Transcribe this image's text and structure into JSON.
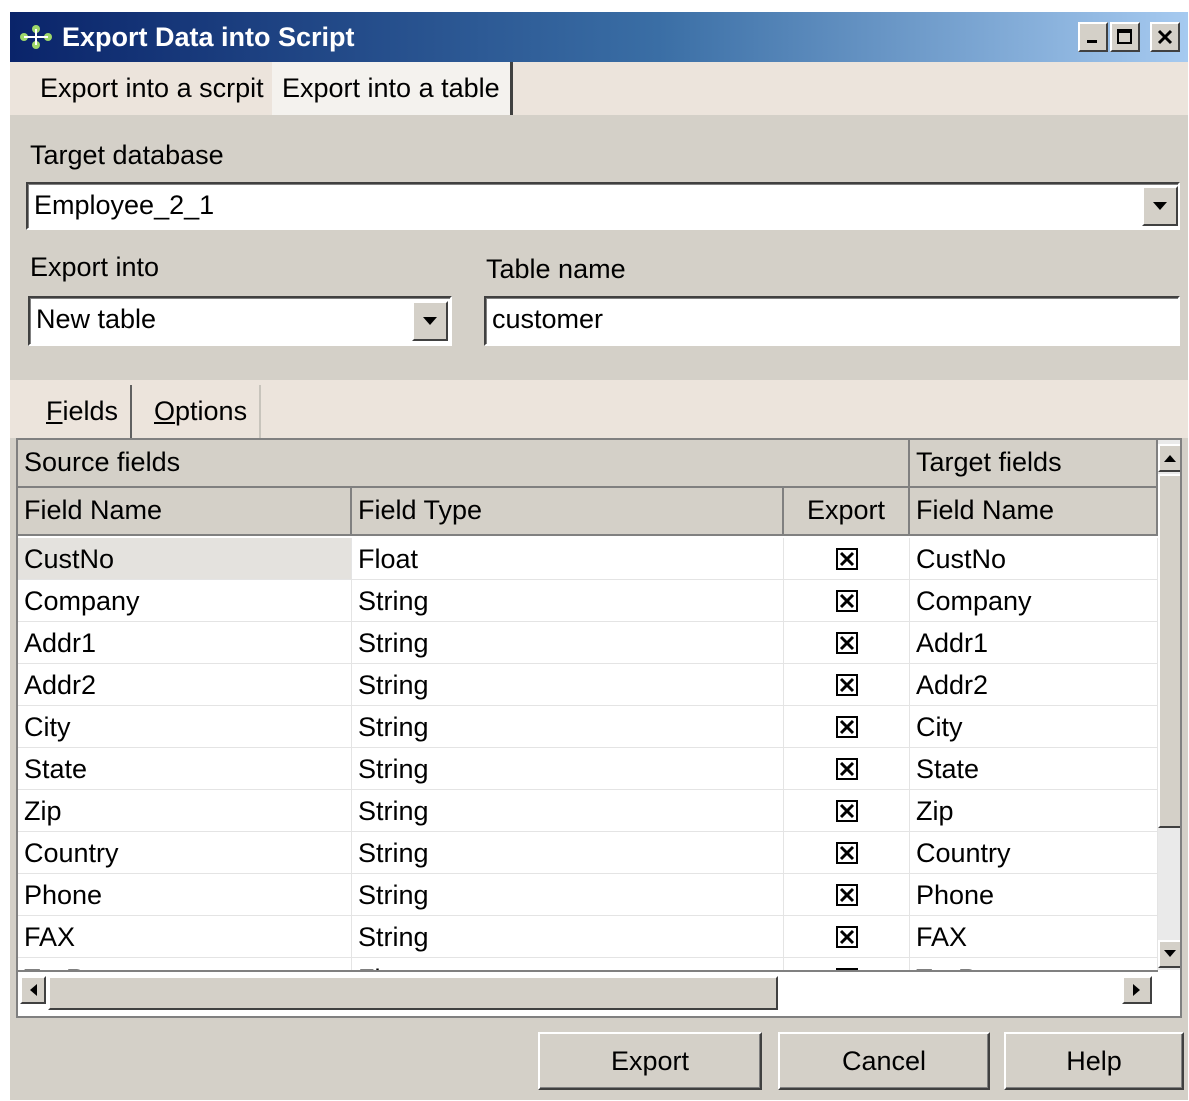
{
  "window": {
    "title": "Export Data into Script",
    "controls": {
      "minimize": "_",
      "maximize": "□",
      "close": "×"
    }
  },
  "tabs": [
    {
      "label": "Export into a scrpit",
      "active": false
    },
    {
      "label": "Export into a table",
      "active": true
    }
  ],
  "form": {
    "target_database_label": "Target database",
    "target_database_value": "Employee_2_1",
    "export_into_label": "Export into",
    "export_into_value": "New table",
    "table_name_label": "Table name",
    "table_name_value": "customer"
  },
  "subtabs": [
    {
      "label": "Fields",
      "mnemonic": "F",
      "rest": "ields",
      "active": true
    },
    {
      "label": "Options",
      "mnemonic": "O",
      "rest": "ptions",
      "active": false
    }
  ],
  "grid": {
    "group_headers": {
      "source": "Source fields",
      "target": "Target fields"
    },
    "columns": {
      "source_field_name": "Field Name",
      "source_field_type": "Field Type",
      "export": "Export",
      "target_field_name": "Field Name"
    },
    "rows": [
      {
        "name": "CustNo",
        "type": "Float",
        "export": true,
        "target": "CustNo",
        "selected": true
      },
      {
        "name": "Company",
        "type": "String",
        "export": true,
        "target": "Company"
      },
      {
        "name": "Addr1",
        "type": "String",
        "export": true,
        "target": "Addr1"
      },
      {
        "name": "Addr2",
        "type": "String",
        "export": true,
        "target": "Addr2"
      },
      {
        "name": "City",
        "type": "String",
        "export": true,
        "target": "City"
      },
      {
        "name": "State",
        "type": "String",
        "export": true,
        "target": "State"
      },
      {
        "name": "Zip",
        "type": "String",
        "export": true,
        "target": "Zip"
      },
      {
        "name": "Country",
        "type": "String",
        "export": true,
        "target": "Country"
      },
      {
        "name": "Phone",
        "type": "String",
        "export": true,
        "target": "Phone"
      },
      {
        "name": "FAX",
        "type": "String",
        "export": true,
        "target": "FAX"
      },
      {
        "name": "TaxRate",
        "type": "Float",
        "export": true,
        "target": "TaxRate"
      }
    ]
  },
  "buttons": {
    "export": "Export",
    "cancel": "Cancel",
    "help": "Help"
  }
}
